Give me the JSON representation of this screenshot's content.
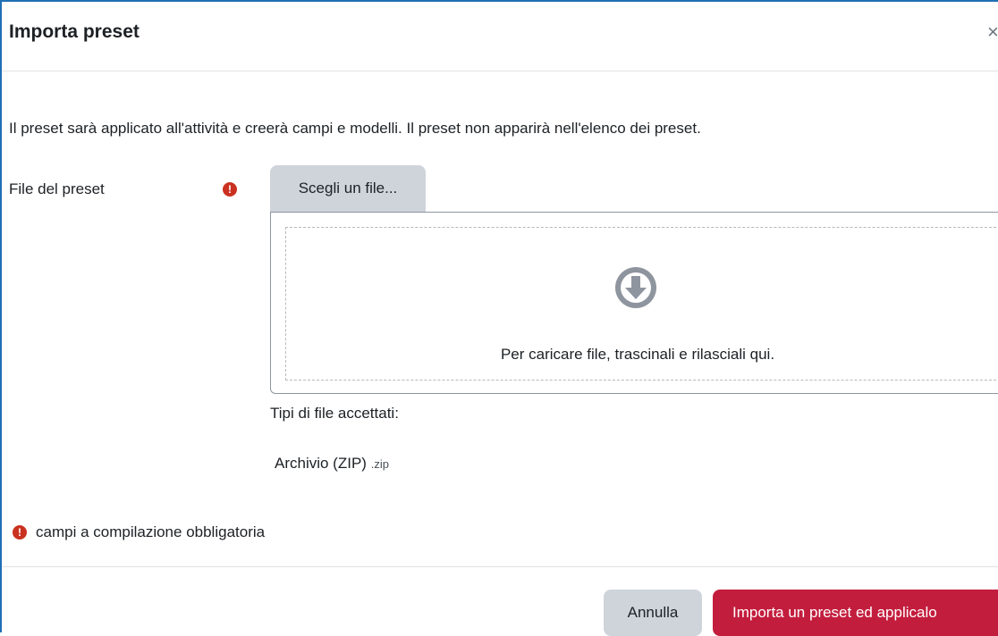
{
  "modal": {
    "title": "Importa preset",
    "close_glyph": "×",
    "intro": "Il preset sarà applicato all'attività e creerà campi e modelli. Il preset non apparirà nell'elenco dei preset."
  },
  "form": {
    "field_label": "File del preset",
    "choose_button": "Scegli un file...",
    "drop_text": "Per caricare file, trascinali e rilasciali qui.",
    "accepted_types_label": "Tipi di file accettati:",
    "accepted_type_name": "Archivio (ZIP)",
    "accepted_type_ext": ".zip",
    "required_legend": "campi a compilazione obbligatoria",
    "required_glyph": "!"
  },
  "footer": {
    "cancel_label": "Annulla",
    "submit_label": "Importa un preset ed applicalo"
  },
  "icons": {
    "required": "exclamation-circle-icon",
    "download": "download-arrow-circle-icon",
    "close": "close-icon"
  },
  "colors": {
    "required": "#ca3120",
    "primary": "#c31d3d",
    "secondary": "#ced4da",
    "frame": "#1f6fb5"
  }
}
